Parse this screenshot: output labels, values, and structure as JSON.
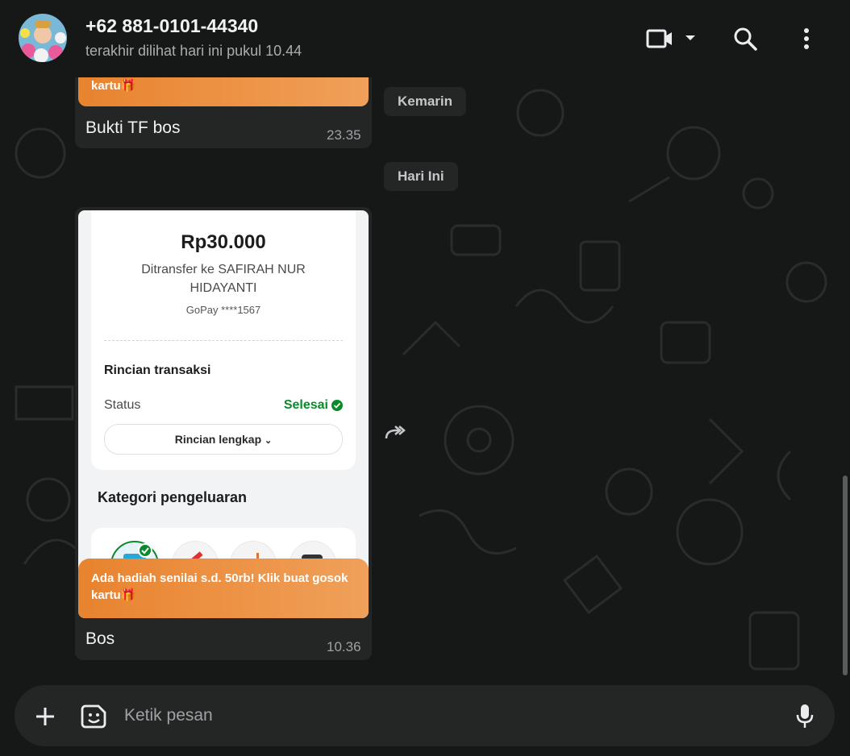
{
  "header": {
    "contact_number": "+62 881-0101-44340",
    "last_seen": "terakhir dilihat hari ini pukul 10.44",
    "icons": [
      "video-call-icon",
      "chevron-down-icon",
      "search-icon",
      "menu-icon"
    ]
  },
  "messages": {
    "first": {
      "promo_tail": "kartu🎁",
      "caption": "Bukti TF bos",
      "time": "23.35"
    },
    "second": {
      "receipt": {
        "amount": "Rp30.000",
        "recipient": "Ditransfer ke SAFIRAH NUR HIDAYANTI",
        "account": "GoPay ****1567",
        "details_title": "Rincian transaksi",
        "status_label": "Status",
        "status_value": "Selesai",
        "details_button": "Rincian lengkap",
        "category_title": "Kategori pengeluaran"
      },
      "promo": "Ada hadiah senilai s.d. 50rb! Klik buat gosok kartu🎁",
      "caption": "Bos",
      "time": "10.36"
    }
  },
  "date_chips": {
    "yesterday": "Kemarin",
    "today": "Hari Ini"
  },
  "composer": {
    "placeholder": "Ketik pesan"
  },
  "colors": {
    "background": "#161717",
    "bubble": "#242626",
    "promo_orange": "#e8832e",
    "status_green": "#0a8a2a"
  }
}
